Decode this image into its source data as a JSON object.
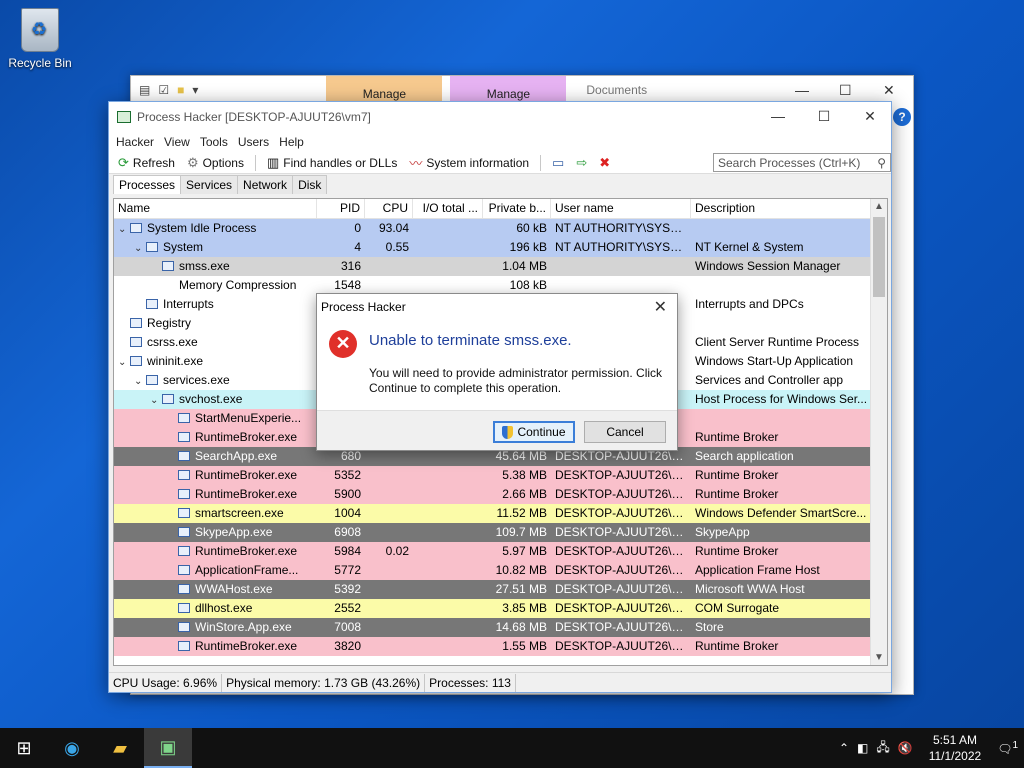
{
  "desktop": {
    "recycle_bin": "Recycle Bin"
  },
  "explorer": {
    "tab_manage_1": "Manage",
    "tab_manage_2": "Manage",
    "tab_documents": "Documents",
    "help_icon": "?"
  },
  "window": {
    "title": "Process Hacker [DESKTOP-AJUUT26\\vm7]",
    "menu": [
      "Hacker",
      "View",
      "Tools",
      "Users",
      "Help"
    ],
    "toolbar": {
      "refresh": "Refresh",
      "options": "Options",
      "find": "Find handles or DLLs",
      "sysinfo": "System information"
    },
    "search_placeholder": "Search Processes (Ctrl+K)",
    "tabs": [
      "Processes",
      "Services",
      "Network",
      "Disk"
    ],
    "columns": [
      "Name",
      "PID",
      "CPU",
      "I/O total ...",
      "Private b...",
      "User name",
      "Description"
    ],
    "rows": [
      {
        "indent": 0,
        "tw": "⌄",
        "name": "System Idle Process",
        "pid": "0",
        "cpu": "93.04",
        "io": "",
        "priv": "60 kB",
        "user": "NT AUTHORITY\\SYSTEM",
        "desc": "",
        "color": "#b7cbf2"
      },
      {
        "indent": 1,
        "tw": "⌄",
        "name": "System",
        "pid": "4",
        "cpu": "0.55",
        "io": "",
        "priv": "196 kB",
        "user": "NT AUTHORITY\\SYSTEM",
        "desc": "NT Kernel & System",
        "color": "#b7cbf2"
      },
      {
        "indent": 2,
        "tw": "",
        "name": "smss.exe",
        "pid": "316",
        "cpu": "",
        "io": "",
        "priv": "1.04 MB",
        "user": "",
        "desc": "Windows Session Manager",
        "color": "#d4d4d4"
      },
      {
        "indent": 2,
        "tw": "",
        "name": "Memory Compression",
        "pid": "1548",
        "cpu": "",
        "io": "",
        "priv": "108 kB",
        "user": "",
        "desc": "",
        "color": "#ffffff",
        "noicon": true
      },
      {
        "indent": 1,
        "tw": "",
        "name": "Interrupts",
        "pid": "",
        "cpu": "",
        "io": "",
        "priv": "",
        "user": "",
        "desc": "Interrupts and DPCs",
        "color": "#ffffff"
      },
      {
        "indent": 0,
        "tw": "",
        "name": "Registry",
        "pid": "",
        "cpu": "",
        "io": "",
        "priv": "",
        "user": "",
        "desc": "",
        "color": "#ffffff"
      },
      {
        "indent": 0,
        "tw": "",
        "name": "csrss.exe",
        "pid": "",
        "cpu": "",
        "io": "",
        "priv": "",
        "user": "",
        "desc": "Client Server Runtime Process",
        "color": "#ffffff"
      },
      {
        "indent": 0,
        "tw": "⌄",
        "name": "wininit.exe",
        "pid": "",
        "cpu": "",
        "io": "",
        "priv": "",
        "user": "",
        "desc": "Windows Start-Up Application",
        "color": "#ffffff"
      },
      {
        "indent": 1,
        "tw": "⌄",
        "name": "services.exe",
        "pid": "",
        "cpu": "",
        "io": "",
        "priv": "",
        "user": "",
        "desc": "Services and Controller app",
        "color": "#ffffff"
      },
      {
        "indent": 2,
        "tw": "⌄",
        "name": "svchost.exe",
        "pid": "",
        "cpu": "",
        "io": "",
        "priv": "",
        "user": "",
        "desc": "Host Process for Windows Ser...",
        "color": "#c9f3f7"
      },
      {
        "indent": 3,
        "tw": "",
        "name": "StartMenuExperie...",
        "pid": "",
        "cpu": "",
        "io": "",
        "priv": "",
        "user": "",
        "desc": "",
        "color": "#f9c0cb"
      },
      {
        "indent": 3,
        "tw": "",
        "name": "RuntimeBroker.exe",
        "pid": "",
        "cpu": "",
        "io": "",
        "priv": "",
        "user": "",
        "desc": "Runtime Broker",
        "color": "#f9c0cb"
      },
      {
        "indent": 3,
        "tw": "",
        "name": "SearchApp.exe",
        "pid": "680",
        "cpu": "",
        "io": "",
        "priv": "45.64 MB",
        "user": "DESKTOP-AJUUT26\\vm7",
        "desc": "Search application",
        "color": "#777777"
      },
      {
        "indent": 3,
        "tw": "",
        "name": "RuntimeBroker.exe",
        "pid": "5352",
        "cpu": "",
        "io": "",
        "priv": "5.38 MB",
        "user": "DESKTOP-AJUUT26\\vm7",
        "desc": "Runtime Broker",
        "color": "#f9c0cb"
      },
      {
        "indent": 3,
        "tw": "",
        "name": "RuntimeBroker.exe",
        "pid": "5900",
        "cpu": "",
        "io": "",
        "priv": "2.66 MB",
        "user": "DESKTOP-AJUUT26\\vm7",
        "desc": "Runtime Broker",
        "color": "#f9c0cb"
      },
      {
        "indent": 3,
        "tw": "",
        "name": "smartscreen.exe",
        "pid": "1004",
        "cpu": "",
        "io": "",
        "priv": "11.52 MB",
        "user": "DESKTOP-AJUUT26\\vm7",
        "desc": "Windows Defender SmartScre...",
        "color": "#fbfba8"
      },
      {
        "indent": 3,
        "tw": "",
        "name": "SkypeApp.exe",
        "pid": "6908",
        "cpu": "",
        "io": "",
        "priv": "109.7 MB",
        "user": "DESKTOP-AJUUT26\\vm7",
        "desc": "SkypeApp",
        "color": "#777777"
      },
      {
        "indent": 3,
        "tw": "",
        "name": "RuntimeBroker.exe",
        "pid": "5984",
        "cpu": "0.02",
        "io": "",
        "priv": "5.97 MB",
        "user": "DESKTOP-AJUUT26\\vm7",
        "desc": "Runtime Broker",
        "color": "#f9c0cb"
      },
      {
        "indent": 3,
        "tw": "",
        "name": "ApplicationFrame...",
        "pid": "5772",
        "cpu": "",
        "io": "",
        "priv": "10.82 MB",
        "user": "DESKTOP-AJUUT26\\vm7",
        "desc": "Application Frame Host",
        "color": "#f9c0cb"
      },
      {
        "indent": 3,
        "tw": "",
        "name": "WWAHost.exe",
        "pid": "5392",
        "cpu": "",
        "io": "",
        "priv": "27.51 MB",
        "user": "DESKTOP-AJUUT26\\vm7",
        "desc": "Microsoft WWA Host",
        "color": "#777777"
      },
      {
        "indent": 3,
        "tw": "",
        "name": "dllhost.exe",
        "pid": "2552",
        "cpu": "",
        "io": "",
        "priv": "3.85 MB",
        "user": "DESKTOP-AJUUT26\\vm7",
        "desc": "COM Surrogate",
        "color": "#fbfba8"
      },
      {
        "indent": 3,
        "tw": "",
        "name": "WinStore.App.exe",
        "pid": "7008",
        "cpu": "",
        "io": "",
        "priv": "14.68 MB",
        "user": "DESKTOP-AJUUT26\\vm7",
        "desc": "Store",
        "color": "#777777"
      },
      {
        "indent": 3,
        "tw": "",
        "name": "RuntimeBroker.exe",
        "pid": "3820",
        "cpu": "",
        "io": "",
        "priv": "1.55 MB",
        "user": "DESKTOP-AJUUT26\\vm7",
        "desc": "Runtime Broker",
        "color": "#f9c0cb"
      }
    ],
    "status": {
      "cpu": "CPU Usage: 6.96%",
      "mem": "Physical memory: 1.73 GB (43.26%)",
      "procs": "Processes: 113"
    }
  },
  "dialog": {
    "title": "Process Hacker",
    "main": "Unable to terminate smss.exe.",
    "sub": "You will need to provide administrator permission. Click Continue to complete this operation.",
    "continue": "Continue",
    "cancel": "Cancel"
  },
  "taskbar": {
    "time": "5:51 AM",
    "date": "11/1/2022",
    "notif_count": "1"
  }
}
